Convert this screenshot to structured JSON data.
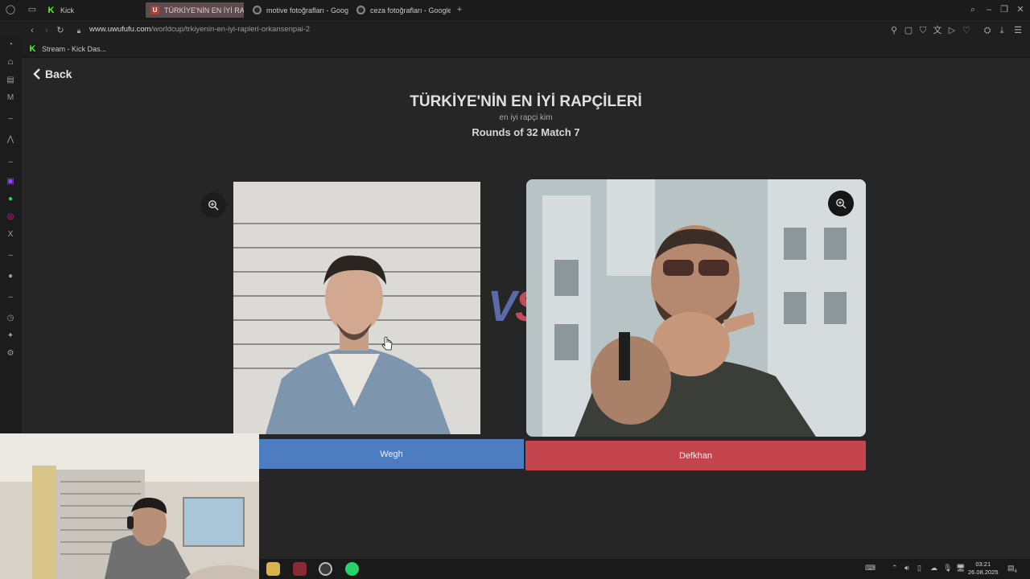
{
  "browser": {
    "tabs": [
      {
        "label": "Kick",
        "favicon": "kick-icon"
      },
      {
        "label": "TÜRKİYE'NİN EN İYİ RAP",
        "favicon": "uwufufu-icon"
      },
      {
        "label": "motive fotoğrafları - Goog",
        "favicon": "google-icon"
      },
      {
        "label": "ceza fotoğrafları - Google",
        "favicon": "google-icon"
      }
    ],
    "new_tab_label": "+",
    "url_domain": "www.uwufufu.com",
    "url_path": "/worldcup/trkiyenin-en-iyi-rapleri-orkansenpai-2",
    "bookmarks": [
      {
        "label": "Stream - Kick Das..."
      }
    ]
  },
  "page": {
    "back_label": "Back",
    "title": "TÜRKİYE'NİN EN İYİ RAPÇİLERİ",
    "subtitle": "en iyi rapçi kim",
    "round_info": "Rounds of 32 Match 7",
    "vs_left": "V",
    "vs_right": "S",
    "left_choice": {
      "name": "Wegh",
      "button_color": "#4d7cc1"
    },
    "right_choice": {
      "name": "Defkhan",
      "button_color": "#c4444e"
    }
  },
  "taskbar": {
    "time": "03:21",
    "date": "26.08.2025",
    "notification_count": "4"
  }
}
